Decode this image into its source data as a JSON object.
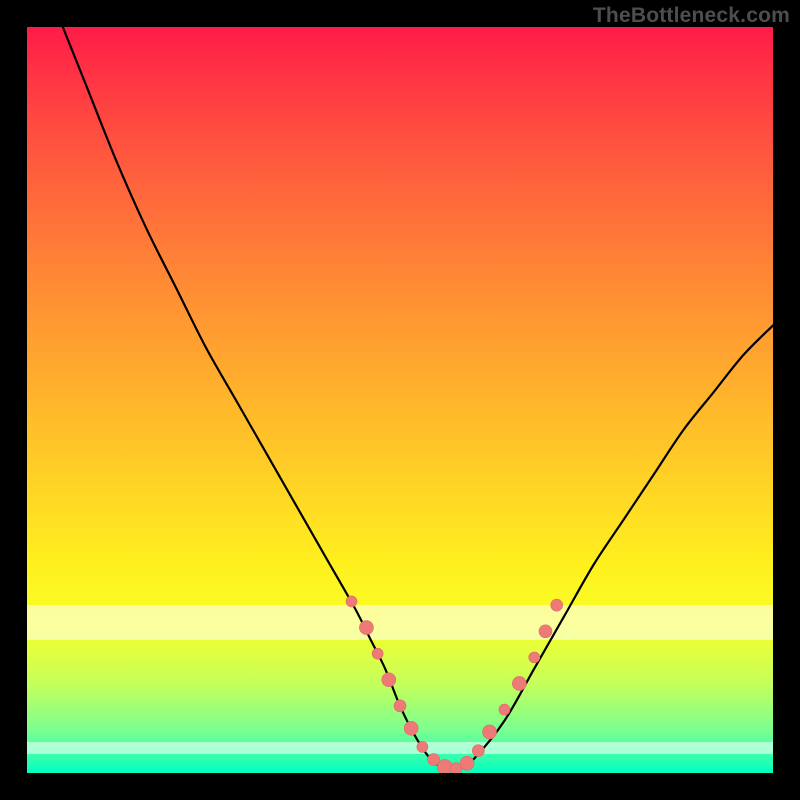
{
  "watermark": "TheBottleneck.com",
  "colors": {
    "curve_stroke": "#000000",
    "marker_fill": "#ee7a78",
    "marker_stroke": "#e06864"
  },
  "chart_data": {
    "type": "line",
    "title": "",
    "xlabel": "",
    "ylabel": "",
    "xlim": [
      0,
      100
    ],
    "ylim": [
      0,
      100
    ],
    "series": [
      {
        "name": "curve",
        "x": [
          4,
          8,
          12,
          16,
          20,
          24,
          28,
          32,
          36,
          40,
          44,
          46,
          48,
          50,
          52,
          54,
          56,
          58,
          60,
          64,
          68,
          72,
          76,
          80,
          84,
          88,
          92,
          96,
          100
        ],
        "y": [
          102,
          92,
          82,
          73,
          65,
          57,
          50,
          43,
          36,
          29,
          22,
          18,
          14,
          9,
          5,
          2,
          0.6,
          0.6,
          2,
          7,
          14,
          21,
          28,
          34,
          40,
          46,
          51,
          56,
          60
        ]
      }
    ],
    "markers": {
      "name": "sweet-spot",
      "x": [
        43.5,
        45.5,
        47.0,
        48.5,
        50.0,
        51.5,
        53.0,
        54.5,
        56.0,
        57.5,
        59.0,
        60.5,
        62.0,
        64.0,
        66.0,
        68.0,
        69.5,
        71.0
      ],
      "y": [
        23.0,
        19.5,
        16.0,
        12.5,
        9.0,
        6.0,
        3.5,
        1.8,
        0.8,
        0.6,
        1.3,
        3.0,
        5.5,
        8.5,
        12.0,
        15.5,
        19.0,
        22.5
      ],
      "r": [
        5.5,
        7.0,
        5.5,
        7.0,
        6.0,
        7.0,
        5.5,
        6.0,
        7.5,
        6.0,
        7.0,
        6.0,
        7.0,
        5.5,
        7.0,
        5.5,
        6.5,
        6.0
      ]
    },
    "bands": [
      {
        "name": "upper-highlight",
        "top_pct": 77.5,
        "height_pct": 4.7,
        "opacity": 0.55
      },
      {
        "name": "lower-highlight",
        "top_pct": 95.8,
        "height_pct": 1.6,
        "opacity": 0.55
      }
    ]
  }
}
